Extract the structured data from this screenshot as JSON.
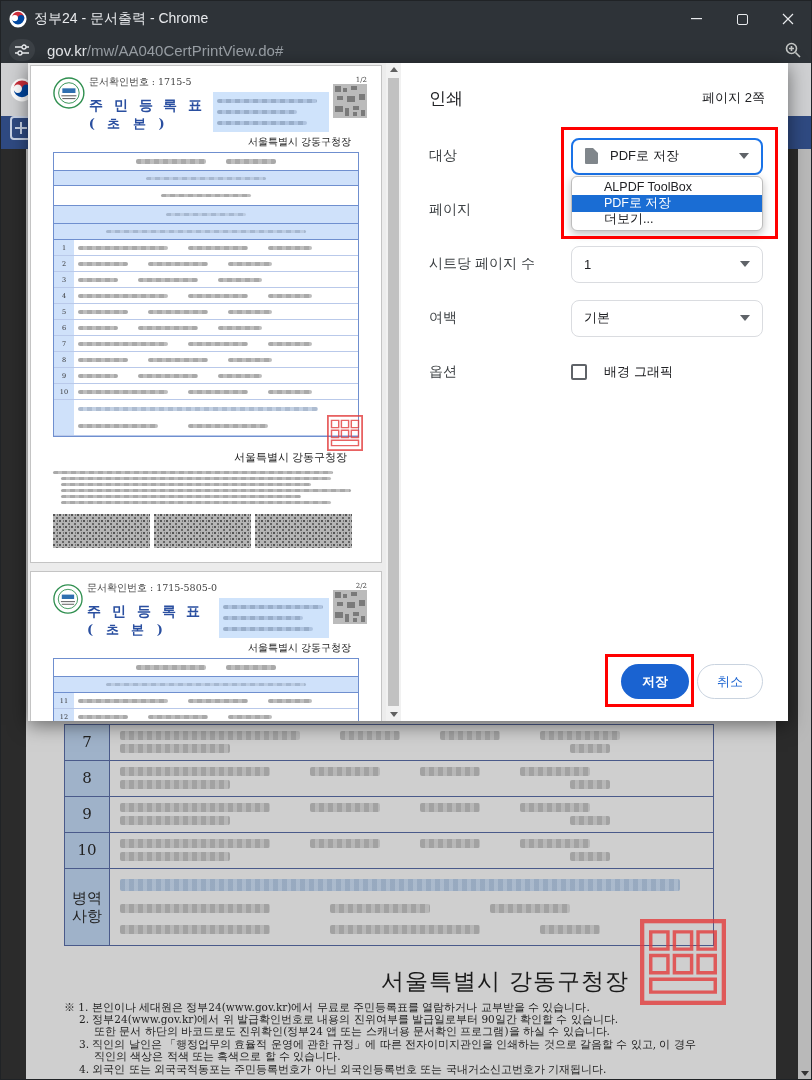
{
  "window": {
    "title": "정부24 - 문서출력 - Chrome"
  },
  "address_bar": {
    "host": "gov.kr",
    "path": "/mw/AA040CertPrintView.do#"
  },
  "print_dialog": {
    "title": "인쇄",
    "page_count": "페이지 2쪽",
    "preview_pages": [
      {
        "page_no": "1/2",
        "doc_number": "문서확인번호 : 1715-5",
        "title": "주 민 등 록 표",
        "subtitle": "( 초 본 )",
        "issuer": "서울특별시 강동구청장",
        "rows": [
          "1",
          "2",
          "3",
          "4",
          "5",
          "6",
          "7",
          "8",
          "9",
          "10"
        ],
        "footer_issuer": "서울특별시 강동구청장"
      },
      {
        "page_no": "2/2",
        "doc_number": "문서확인번호 : 1715-5805-0",
        "title": "주 민 등 록 표",
        "subtitle": "( 초 본 )",
        "issuer": "서울특별시 강동구청장",
        "rows": [
          "11",
          "12"
        ]
      }
    ],
    "settings": [
      {
        "label": "대상",
        "kind": "destination",
        "value": "PDF로 저장",
        "focused": true,
        "highlighted": true
      },
      {
        "label": "페이지",
        "kind": "covered"
      },
      {
        "label": "시트당 페이지 수",
        "kind": "select",
        "value": "1"
      },
      {
        "label": "여백",
        "kind": "select",
        "value": "기본"
      },
      {
        "label": "옵션",
        "kind": "checkbox",
        "text": "배경 그래픽",
        "checked": false
      }
    ],
    "dropdown": [
      {
        "label": "ALPDF ToolBox",
        "selected": false
      },
      {
        "label": "PDF로 저장",
        "selected": true
      },
      {
        "label": "더보기...",
        "selected": false
      }
    ],
    "buttons": [
      {
        "label": "저장",
        "kind": "primary",
        "highlighted": true
      },
      {
        "label": "취소",
        "kind": "secondary",
        "highlighted": false
      }
    ]
  },
  "background_document": {
    "rows": [
      "7",
      "8",
      "9",
      "10"
    ],
    "military_label": "병역 사항",
    "issuer": "서울특별시 강동구청장",
    "notes": [
      {
        "kind": "first",
        "text": "※ 1. 본인이나 세대원은 정부24(www.gov.kr)에서 무료로 주민등록표를 열람하거나 교부받을 수 있습니다."
      },
      {
        "kind": "item",
        "text": "2. 정부24(www.gov.kr)에서 위 발급확인번호로 내용의 진위여부를 발급일로부터 90일간 확인할 수 있습니다."
      },
      {
        "kind": "continuation",
        "text": "또한 문서 하단의 바코드로도 진위확인(정부24 앱 또는 스캐너용 문서확인 프로그램)을 하실 수 있습니다."
      },
      {
        "kind": "item",
        "text": "3. 직인의 날인은 「행정업무의 효율적 운영에 관한 규정」에 따른 전자이미지관인을 인쇄하는 것으로 갈음할 수 있고, 이 경우"
      },
      {
        "kind": "continuation",
        "text": "직인의 색상은 적색 또는 흑색으로 할 수 있습니다."
      },
      {
        "kind": "item",
        "text": "4. 외국인 또는 외국국적동포는 주민등록번호가 아닌 외국인등록번호 또는 국내거소신고번호가 기재됩니다."
      }
    ]
  }
}
